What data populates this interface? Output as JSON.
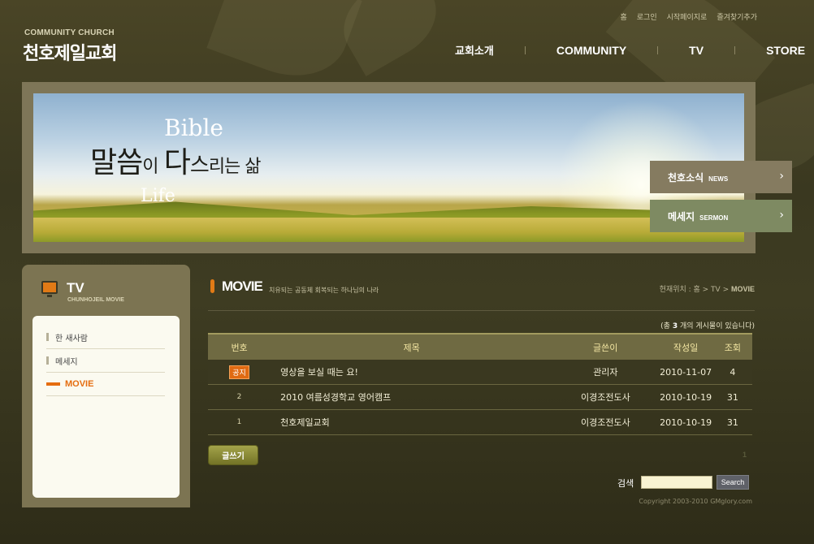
{
  "top_links": [
    "홈",
    "로그인",
    "시작페이지로",
    "즐겨찾기추가"
  ],
  "logo": {
    "sub": "COMMUNITY CHURCH",
    "main": "천호제일교회"
  },
  "nav": [
    {
      "label": "교회소개"
    },
    {
      "label": "COMMUNITY"
    },
    {
      "label": "TV"
    },
    {
      "label": "STORE"
    }
  ],
  "banner": {
    "bible": "Bible",
    "life": "Life",
    "line_1": "말씀",
    "line_2": "이",
    "line_3": "다",
    "line_4": "스",
    "line_5": "리는 삶"
  },
  "side_buttons": [
    {
      "kr": "천호소식",
      "en": "NEWS"
    },
    {
      "kr": "메세지",
      "en": "SERMON"
    }
  ],
  "section": {
    "title": "TV",
    "subtitle": "CHUNHOJEIL MOVIE"
  },
  "sub_menu": [
    {
      "label": "한 새사람",
      "active": false
    },
    {
      "label": "메세지",
      "active": false
    },
    {
      "label": "MOVIE",
      "active": true
    }
  ],
  "content": {
    "title": "MOVIE",
    "description": "치유되는 공동체 회복되는 하나님의 나라",
    "location_prefix": "현재위치 : 홈 > TV > ",
    "location_current": "MOVIE",
    "total_prefix": "(총 ",
    "total_count": "3",
    "total_suffix": " 개의 게시물이 있습니다)"
  },
  "table": {
    "headers": {
      "no": "번호",
      "title": "제목",
      "writer": "글쓴이",
      "date": "작성일",
      "views": "조회"
    },
    "rows": [
      {
        "no": "공지",
        "title": "영상을 보실 때는 요!",
        "writer": "관리자",
        "date": "2010-11-07",
        "views": "4"
      },
      {
        "no": "2",
        "title": "2010 여름성경학교 영어캠프",
        "writer": "이경조전도사",
        "date": "2010-10-19",
        "views": "31"
      },
      {
        "no": "1",
        "title": "천호제일교회",
        "writer": "이경조전도사",
        "date": "2010-10-19",
        "views": "31"
      }
    ]
  },
  "write_button": "글쓰기",
  "pagination": {
    "current": "1"
  },
  "search": {
    "label": "검색",
    "value": "",
    "button": "Search"
  },
  "footer": {
    "copyright": "Copyright 2003-2010 GMglory.com"
  }
}
